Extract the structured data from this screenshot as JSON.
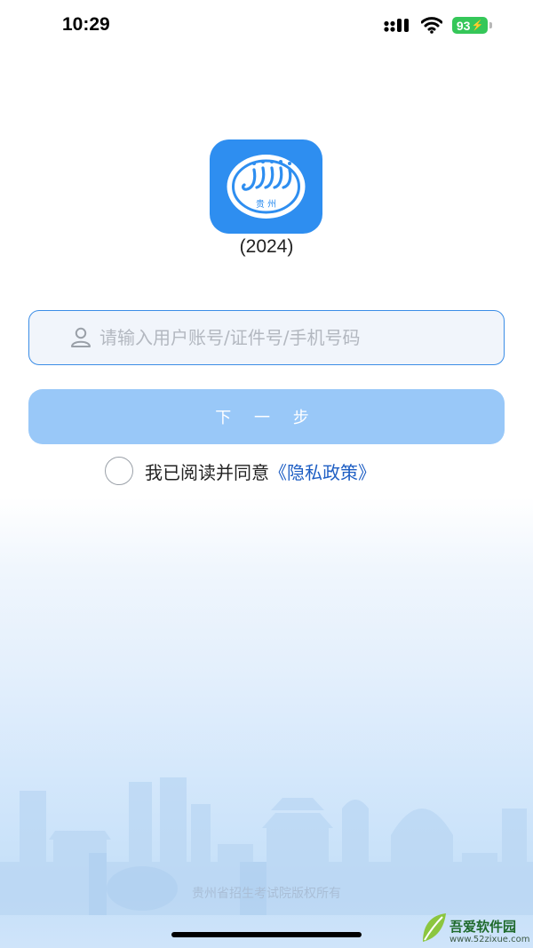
{
  "status_bar": {
    "time": "10:29",
    "battery": "93"
  },
  "logo": {
    "emblem_text": "贵 州",
    "version": "(2024)"
  },
  "login": {
    "account_placeholder": "请输入用户账号/证件号/手机号码",
    "account_value": "",
    "next_label": "下 一 步",
    "agreement_text": "我已阅读并同意",
    "privacy_link": "《隐私政策》"
  },
  "footer": {
    "copyright": "贵州省招生考试院版权所有"
  },
  "watermark": {
    "title": "吾爱软件园",
    "url": "www.52zixue.com"
  },
  "colors": {
    "accent": "#3b8de6",
    "button_disabled": "#99c8f8",
    "logo_blue": "#2e8ef0",
    "link": "#1f5fc4"
  },
  "icons": [
    "signal-icon",
    "wifi-icon",
    "battery-icon",
    "user-icon",
    "app-logo"
  ]
}
